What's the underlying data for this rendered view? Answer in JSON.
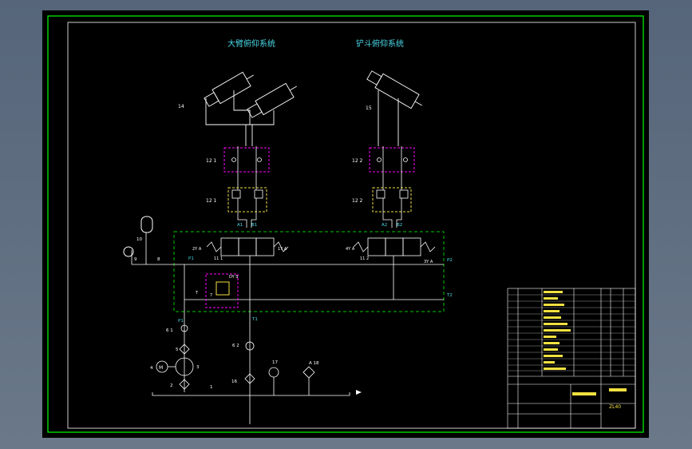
{
  "titles": {
    "boom_system": "大臂俯仰系统",
    "bucket_system": "铲斗俯仰系统"
  },
  "labels": {
    "cyl_left": "14",
    "cyl_right": "15",
    "lock_left": "12 1",
    "lock_right": "12 2",
    "throttle_left": "12 1",
    "throttle_right": "12 2",
    "port_a1": "A1",
    "port_b1": "B1",
    "port_a2": "A2",
    "port_b2": "B2",
    "accumulator": "10",
    "gauge": "9",
    "valve_8": "8",
    "port_p1_top": "P1",
    "port_p2": "P2",
    "port_t2": "T2",
    "port_t": "T",
    "port_p1_bottom": "P1",
    "port_t1": "T1",
    "dir_valve_left": "11 1",
    "dir_valve_right": "11 2",
    "solenoid_1ya": "1Y A",
    "solenoid_2ya": "2Y A",
    "solenoid_3ya": "3Y A",
    "solenoid_4ya": "4Y A",
    "relief": "7",
    "relief_code": "DY S",
    "filter_6": "6 1",
    "filter_62": "6 2",
    "motor": "4",
    "motor_letter": "M",
    "coupling": "3",
    "pump": "5",
    "suction": "2",
    "tank": "1",
    "item16": "16",
    "item17": "17",
    "item18": "A 18"
  },
  "title_block": {
    "drawing_no": "ZL40",
    "part_names_rows": 14
  },
  "colors": {
    "line": "#ffffff",
    "frame": "#00ff00",
    "dashed_group": "#00c800",
    "lock_box": "#ff00ff",
    "throttle_box": "#f0e040",
    "title_text": "#4ad9e8",
    "label_text": "#ffffff"
  }
}
